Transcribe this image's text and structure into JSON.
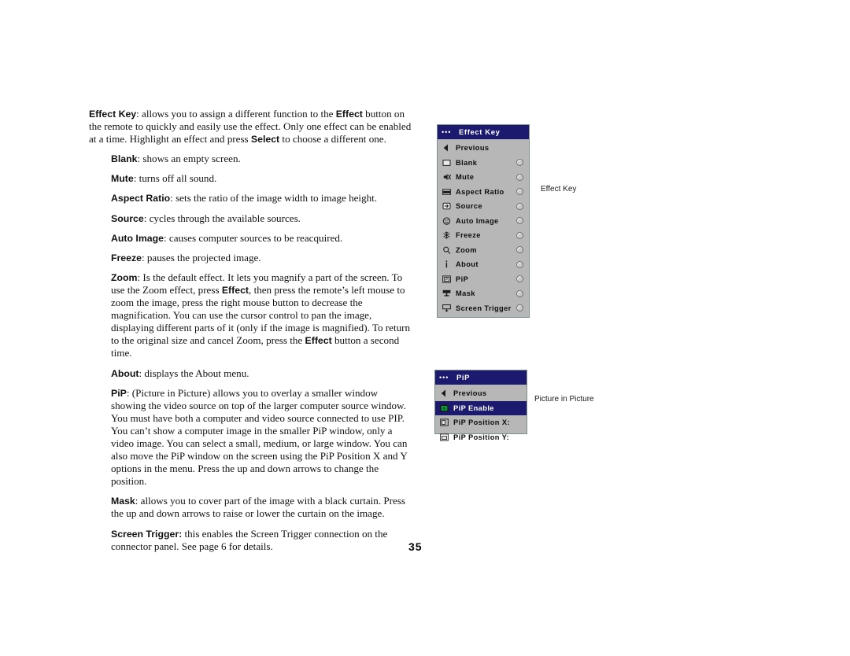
{
  "page": {
    "number": "35"
  },
  "body_text": {
    "paragraphs": [
      {
        "id": "effect-key-intro",
        "indented": false,
        "html": "<b>Effect Key</b>: allows you to assign a different function to the <b>Effect</b> button on the remote to quickly and easily use the effect. Only one effect can be enabled at a time. Highlight an effect and press <b>Select</b> to choose a different one."
      },
      {
        "id": "blank",
        "indented": true,
        "html": "<b>Blank</b>: shows an empty screen."
      },
      {
        "id": "mute",
        "indented": true,
        "html": "<b>Mute</b>: turns off all sound."
      },
      {
        "id": "aspect-ratio",
        "indented": true,
        "html": "<b>Aspect Ratio</b>: sets the ratio of the image width to image height."
      },
      {
        "id": "source",
        "indented": true,
        "html": "<b>Source</b>: cycles through the available sources."
      },
      {
        "id": "auto-image",
        "indented": true,
        "html": "<b>Auto Image</b>: causes computer sources to be reacquired."
      },
      {
        "id": "freeze",
        "indented": true,
        "html": "<b>Freeze</b>: pauses the projected image."
      },
      {
        "id": "zoom",
        "indented": true,
        "html": "<b>Zoom</b>: Is the default effect. It lets you magnify a part of the screen. To use the Zoom effect, press <b>Effect</b>, then press the remote&rsquo;s left mouse to zoom the image, press the right mouse button to decrease the magnification. You can use the cursor control to pan the image, displaying different parts of it (only if the image is magnified). To return to the original size and cancel Zoom, press the <b>Effect</b> button a second time."
      },
      {
        "id": "about",
        "indented": true,
        "html": "<b>About</b>: displays the About menu."
      },
      {
        "id": "pip",
        "indented": true,
        "html": "<b>PiP</b>: (Picture in Picture) allows you to overlay a smaller window showing the video source on top of the larger computer source window. You must have both a computer and video source connected to use PIP. You can&rsquo;t show a computer image in the smaller PiP window, only a video image. You can select a small, medium, or large window. You can also move the PiP window on the screen using the PiP Position X and Y options in the menu. Press the up and down arrows to change the position."
      },
      {
        "id": "mask",
        "indented": true,
        "html": "<b>Mask</b>: allows you to cover part of the image with a black curtain. Press the up and down arrows to raise or lower the curtain on the image."
      },
      {
        "id": "screen-trigger",
        "indented": true,
        "html": "<b>Screen Trigger:</b> this enables the Screen Trigger connection on the connector panel. See page 6 for details."
      }
    ]
  },
  "effect_key_menu": {
    "titlebar": {
      "dots": "•••",
      "title": "Effect Key"
    },
    "rows": [
      {
        "icon": "previous-arrow-icon",
        "label": "Previous",
        "radio": false,
        "selected": false
      },
      {
        "icon": "blank-screen-icon",
        "label": "Blank",
        "radio": true,
        "selected": false
      },
      {
        "icon": "mute-speaker-icon",
        "label": "Mute",
        "radio": true,
        "selected": false
      },
      {
        "icon": "aspect-ratio-icon",
        "label": "Aspect Ratio",
        "radio": true,
        "selected": false
      },
      {
        "icon": "source-icon",
        "label": "Source",
        "radio": true,
        "selected": false
      },
      {
        "icon": "auto-image-icon",
        "label": "Auto Image",
        "radio": true,
        "selected": false
      },
      {
        "icon": "freeze-icon",
        "label": "Freeze",
        "radio": true,
        "selected": false
      },
      {
        "icon": "zoom-magnifier-icon",
        "label": "Zoom",
        "radio": true,
        "selected": false
      },
      {
        "icon": "about-info-icon",
        "label": "About",
        "radio": true,
        "selected": false
      },
      {
        "icon": "pip-icon",
        "label": "PiP",
        "radio": true,
        "selected": false
      },
      {
        "icon": "mask-curtain-icon",
        "label": "Mask",
        "radio": true,
        "selected": false
      },
      {
        "icon": "screen-trigger-icon",
        "label": "Screen Trigger",
        "radio": true,
        "selected": false
      }
    ]
  },
  "pip_menu": {
    "titlebar": {
      "dots": "•••",
      "title": "PiP"
    },
    "rows": [
      {
        "icon": "previous-arrow-icon",
        "label": "Previous",
        "selected": false
      },
      {
        "icon": "pip-enable-icon",
        "label": "PiP Enable",
        "selected": true
      },
      {
        "icon": "pip-position-x-icon",
        "label": "PiP Position X:",
        "selected": false
      },
      {
        "icon": "pip-position-y-icon",
        "label": "PiP Position Y:",
        "selected": false
      }
    ]
  },
  "callouts": {
    "effect_key": "Effect Key",
    "picture_in_picture": "Picture in Picture"
  },
  "colors": {
    "menu_background": "#b7b7b7",
    "menu_border": "#7d8c8c",
    "titlebar_navy": "#1b1a6e",
    "highlight_navy": "#1b1a6e",
    "pip_enable_green": "#0aa03c",
    "text_black": "#0d0d0d",
    "text_white": "#ffffff"
  }
}
